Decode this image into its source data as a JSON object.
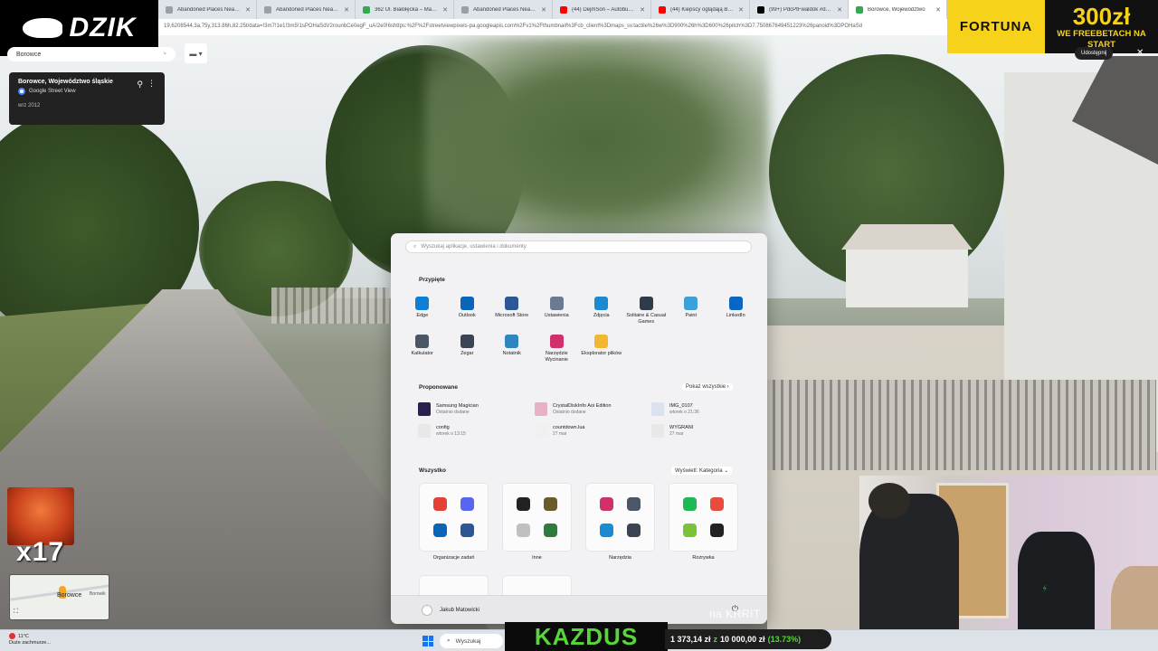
{
  "browser": {
    "tabs": [
      {
        "title": "Abandoned Places Near Me - L",
        "favicon_color": "#9aa0a6",
        "active": false
      },
      {
        "title": "Abandoned Places Near Me - L",
        "favicon_color": "#9aa0a6",
        "active": false
      },
      {
        "title": "362 Ul. Białołęcka – Mapy Goog",
        "favicon_color": "#34a853",
        "active": false
      },
      {
        "title": "Abandoned Places Near Me - L",
        "favicon_color": "#9aa0a6",
        "active": false
      },
      {
        "title": "(44) DejmSon – Autobus w pa",
        "favicon_color": "#ff0000",
        "active": false
      },
      {
        "title": "(44) Kiepscy oglądają Braci z G",
        "favicon_color": "#ff0000",
        "active": false
      },
      {
        "title": "(99+) PdcPtFwaldok #dobrog",
        "favicon_color": "#000000",
        "active": false
      },
      {
        "title": "Borowce, Województwo",
        "favicon_color": "#34a853",
        "active": true
      }
    ],
    "url": "19,6208544,3a,75y,313.86h,82.25t/data=!3m7!1e1!3m5!1sPOHaSdV2rounbCe0egF_uA!2e0!6shttps:%2F%2Fstreetviewpixels-pa.googleapis.com%2Fv1%2Fthumbnail%3Fcb_client%3Dmaps_sv.tactile%26w%3D900%26h%3D600%26pitch%3D7.750867649451223%26panoid%3DPOHaSd"
  },
  "overlays": {
    "dzik_brand": "DZIK",
    "fortuna_brand": "FORTUNA",
    "fortuna_amount": "300zł",
    "fortuna_sub": "WE FREEBETACH NA START",
    "emote_count": "x17",
    "kazdus": "KAZDUS",
    "balance": {
      "current": "1 373,14 zł",
      "separator": "z",
      "goal": "10 000,00 zł",
      "percent": "(13.73%)"
    },
    "watermark": "na KRRIT"
  },
  "maps": {
    "search_value": "Borowce",
    "place_title": "Borowce, Województwo śląskie",
    "place_source": "Google Street View",
    "place_date": "wrz 2012",
    "share_label": "Udostępnij",
    "minimap_label": "Borowce",
    "minimap_label2": "Borowik"
  },
  "start_menu": {
    "search_placeholder": "Wyszukaj aplikacje, ustawienia i dokumenty",
    "pinned_title": "Przypięte",
    "pinned": [
      {
        "label": "Edge",
        "icon": "edge-icon",
        "color": "#0f7fd6"
      },
      {
        "label": "Outlook",
        "icon": "outlook-icon",
        "color": "#0a64b8"
      },
      {
        "label": "Microsoft Store",
        "icon": "store-icon",
        "color": "#2b5797"
      },
      {
        "label": "Ustawienia",
        "icon": "settings-icon",
        "color": "#6b7a8f"
      },
      {
        "label": "Zdjęcia",
        "icon": "photos-icon",
        "color": "#1b8ad3"
      },
      {
        "label": "Solitaire & Casual Games",
        "icon": "solitaire-icon",
        "color": "#2f3b4a"
      },
      {
        "label": "Paint",
        "icon": "paint-icon",
        "color": "#3fa0d8"
      },
      {
        "label": "LinkedIn",
        "icon": "linkedin-icon",
        "color": "#0a66c2"
      },
      {
        "label": "Kalkulator",
        "icon": "calculator-icon",
        "color": "#4a5766"
      },
      {
        "label": "Zegar",
        "icon": "clock-icon",
        "color": "#3a4452"
      },
      {
        "label": "Notatnik",
        "icon": "notepad-icon",
        "color": "#2e86c1"
      },
      {
        "label": "Narzędzie Wycinanie",
        "icon": "snipping-icon",
        "color": "#d0306b"
      },
      {
        "label": "Eksplorator plików",
        "icon": "folder-icon",
        "color": "#f2b731"
      }
    ],
    "recommended_title": "Proponowane",
    "recommended_link": "Pokaż wszystkie  ›",
    "recommended": [
      {
        "name": "Samsung Magician",
        "sub": "Ostatnio dodane",
        "color": "#2a1f4f"
      },
      {
        "name": "CrystalDiskInfo Aoi Edition",
        "sub": "Ostatnio dodane",
        "color": "#e7b0c4"
      },
      {
        "name": "IMG_0107",
        "sub": "wtorek o 21:36",
        "color": "#d9e2ee"
      },
      {
        "name": "config",
        "sub": "wtorek o 13:15",
        "color": "#e8e8e8"
      },
      {
        "name": "countdown.lua",
        "sub": "27 mar",
        "color": "#f0f0f0"
      },
      {
        "name": "WYGRANI",
        "sub": "27 mar",
        "color": "#e8e8e8"
      }
    ],
    "all_title": "Wszystko",
    "all_link": "Wyświetl: Kategoria  ⌄",
    "categories": [
      {
        "label": "Organizacje zadań",
        "icons": [
          "#e34133",
          "#5865f2",
          "#0a64b8",
          "#2b5797"
        ]
      },
      {
        "label": "Inne",
        "icons": [
          "#222222",
          "#6b5a2a",
          "#c0c0c0",
          "#2f7a3f"
        ]
      },
      {
        "label": "Narzędzia",
        "icons": [
          "#d0306b",
          "#4a5766",
          "#1b8ad3",
          "#3a4452"
        ]
      },
      {
        "label": "Rozrywka",
        "icons": [
          "#1db954",
          "#e84c3d",
          "#7ac23a",
          "#222222"
        ]
      }
    ],
    "user_name": "Jakub Matowicki"
  },
  "taskbar": {
    "weather_temp": "11°C",
    "weather_desc": "Duże zachmurze...",
    "search_label": "Wyszukaj"
  }
}
